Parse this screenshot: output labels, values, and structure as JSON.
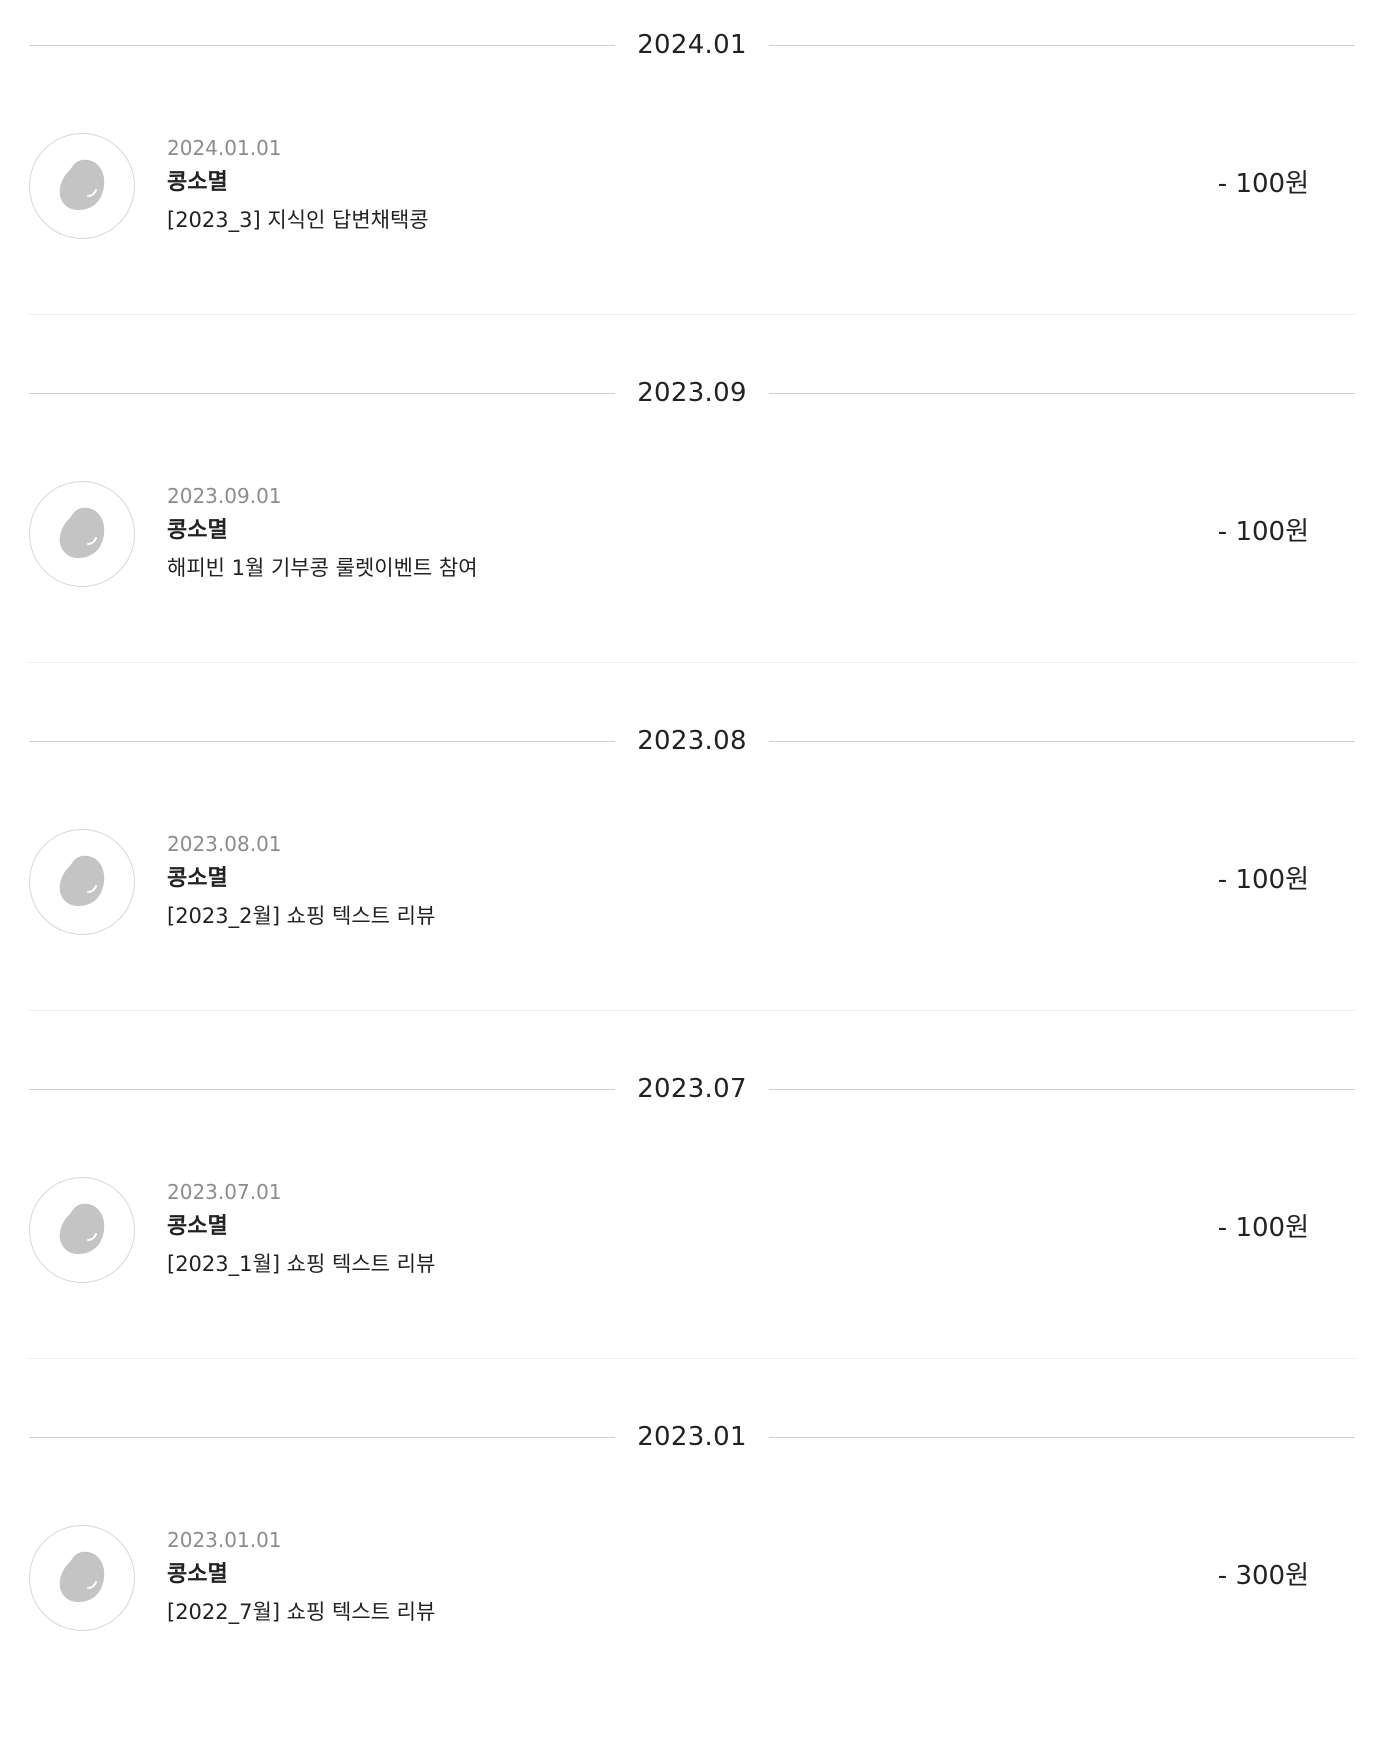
{
  "sections": [
    {
      "month": "2024.01",
      "entry": {
        "date": "2024.01.01",
        "source": "콩소멸",
        "description": "[2023_3] 지식인 답변채택콩",
        "amount": "- 100원",
        "icon": "bean-icon"
      }
    },
    {
      "month": "2023.09",
      "entry": {
        "date": "2023.09.01",
        "source": "콩소멸",
        "description": "해피빈 1월 기부콩 룰렛이벤트 참여",
        "amount": "- 100원",
        "icon": "bean-icon"
      }
    },
    {
      "month": "2023.08",
      "entry": {
        "date": "2023.08.01",
        "source": "콩소멸",
        "description": "[2023_2월] 쇼핑 텍스트 리뷰",
        "amount": "- 100원",
        "icon": "bean-icon"
      }
    },
    {
      "month": "2023.07",
      "entry": {
        "date": "2023.07.01",
        "source": "콩소멸",
        "description": "[2023_1월] 쇼핑 텍스트 리뷰",
        "amount": "- 100원",
        "icon": "bean-icon"
      }
    },
    {
      "month": "2023.01",
      "entry": {
        "date": "2023.01.01",
        "source": "콩소멸",
        "description": "[2022_7월] 쇼핑 텍스트 리뷰",
        "amount": "- 300원",
        "icon": "bean-icon"
      }
    }
  ],
  "colors": {
    "bean": "#c4c4c4",
    "divider": "#ececec",
    "month_line": "#cfcfcf",
    "date_text": "#8c8c8c"
  }
}
